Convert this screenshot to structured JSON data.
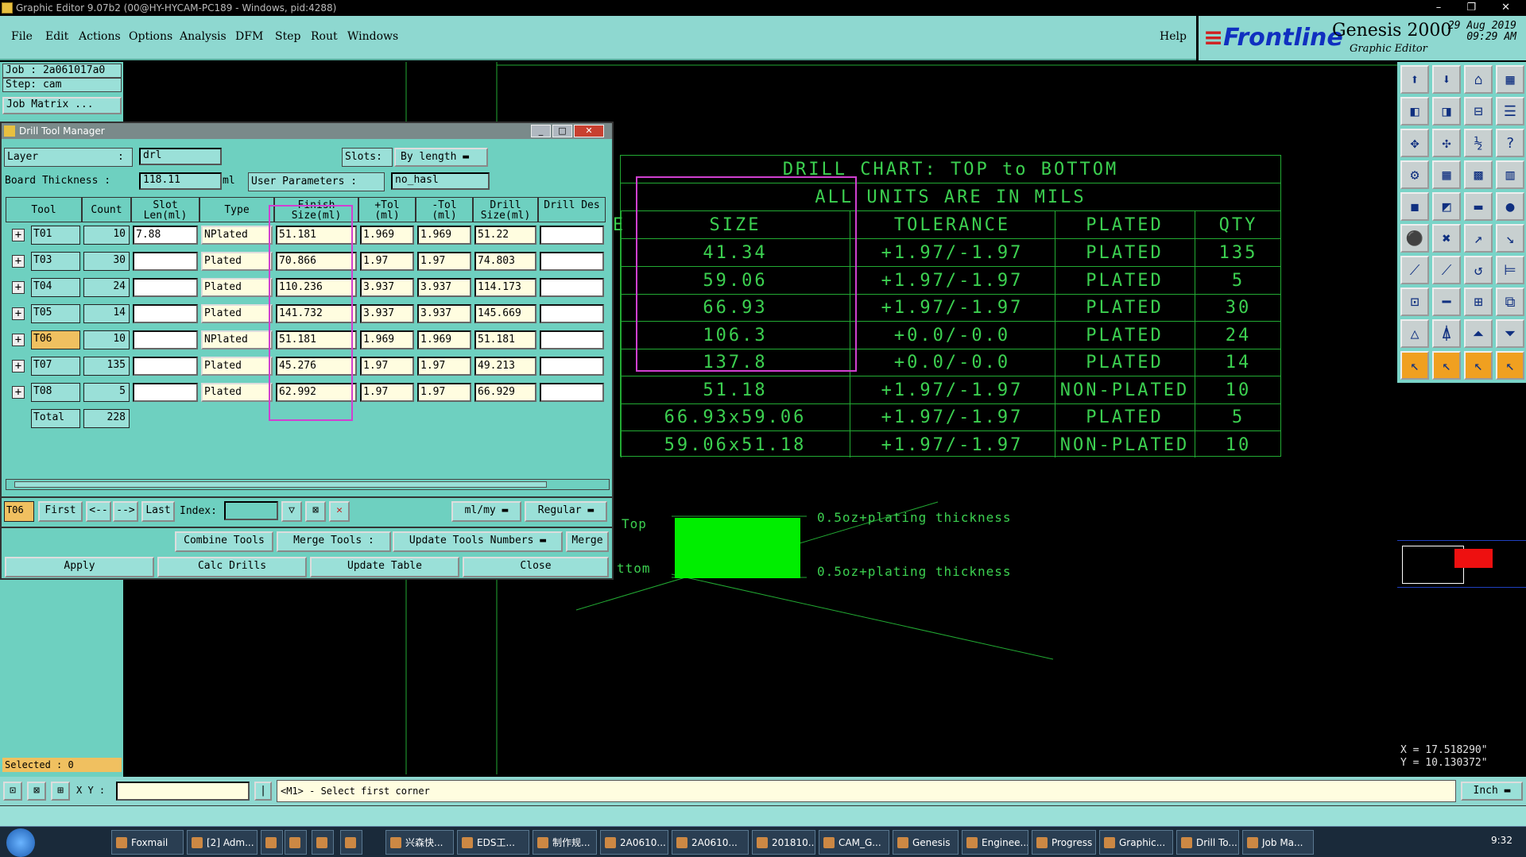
{
  "titlebar": {
    "text": "Graphic Editor 9.07b2 (00@HY-HYCAM-PC189 - Windows, pid:4288)",
    "controls": "– ❐ ✕"
  },
  "menu": [
    "File",
    "Edit",
    "Actions",
    "Options",
    "Analysis",
    "DFM",
    "Step",
    "Rout",
    "Windows"
  ],
  "help": "Help",
  "brand": {
    "logo": "Frontline",
    "product": "Genesis 2000",
    "subtitle": "Graphic Editor",
    "date": "29 Aug 2019",
    "time": "09:29 AM"
  },
  "left": {
    "job": "Job : 2a061017a0",
    "step": "Step: cam",
    "job_matrix": "Job Matrix ...",
    "selected": "Selected : 0"
  },
  "dialog": {
    "title": "Drill Tool Manager",
    "layer_label": "Layer",
    "layer_sep": ":",
    "layer_value": "drl",
    "slots_label": "Slots:",
    "slots_value": "By length",
    "board_label": "Board Thickness :",
    "board_value": "118.11",
    "board_unit": "ml",
    "user_params_label": "User Parameters :",
    "user_params_value": "no_hasl",
    "columns": [
      "Tool",
      "Count",
      "Slot Len(ml)",
      "Type",
      "Finish Size(ml)",
      "+Tol (ml)",
      "-Tol (ml)",
      "Drill Size(ml)",
      "Drill Des"
    ],
    "rows": [
      {
        "tool": "T01",
        "count": "10",
        "slot": "7.88",
        "type": "NPlated",
        "finish": "51.181",
        "ptol": "1.969",
        "ntol": "1.969",
        "drill": "51.22",
        "des": ""
      },
      {
        "tool": "T03",
        "count": "30",
        "slot": "",
        "type": "Plated",
        "finish": "70.866",
        "ptol": "1.97",
        "ntol": "1.97",
        "drill": "74.803",
        "des": ""
      },
      {
        "tool": "T04",
        "count": "24",
        "slot": "",
        "type": "Plated",
        "finish": "110.236",
        "ptol": "3.937",
        "ntol": "3.937",
        "drill": "114.173",
        "des": ""
      },
      {
        "tool": "T05",
        "count": "14",
        "slot": "",
        "type": "Plated",
        "finish": "141.732",
        "ptol": "3.937",
        "ntol": "3.937",
        "drill": "145.669",
        "des": ""
      },
      {
        "tool": "T06",
        "count": "10",
        "slot": "",
        "type": "NPlated",
        "finish": "51.181",
        "ptol": "1.969",
        "ntol": "1.969",
        "drill": "51.181",
        "des": ""
      },
      {
        "tool": "T07",
        "count": "135",
        "slot": "",
        "type": "Plated",
        "finish": "45.276",
        "ptol": "1.97",
        "ntol": "1.97",
        "drill": "49.213",
        "des": ""
      },
      {
        "tool": "T08",
        "count": "5",
        "slot": "",
        "type": "Plated",
        "finish": "62.992",
        "ptol": "1.97",
        "ntol": "1.97",
        "drill": "66.929",
        "des": ""
      }
    ],
    "total_label": "Total",
    "total_value": "228",
    "current_tool": "T06",
    "nav": {
      "first": "First",
      "prev": "<--",
      "next": "-->",
      "last": "Last",
      "index_label": "Index:"
    },
    "units_value": "ml/my",
    "mode_value": "Regular",
    "combine": "Combine Tools",
    "merge_tools": "Merge Tools :",
    "update_numbers": "Update Tools Numbers",
    "merge": "Merge",
    "apply": "Apply",
    "calc": "Calc Drills",
    "update_table": "Update Table",
    "close": "Close"
  },
  "chart": {
    "title": "DRILL CHART: TOP to BOTTOM",
    "subtitle": "ALL UNITS ARE IN MILS",
    "left_fragment": "E",
    "headers": [
      "SIZE",
      "TOLERANCE",
      "PLATED",
      "QTY"
    ],
    "rows": [
      [
        "41.34",
        "+1.97/-1.97",
        "PLATED",
        "135"
      ],
      [
        "59.06",
        "+1.97/-1.97",
        "PLATED",
        "5"
      ],
      [
        "66.93",
        "+1.97/-1.97",
        "PLATED",
        "30"
      ],
      [
        "106.3",
        "+0.0/-0.0",
        "PLATED",
        "24"
      ],
      [
        "137.8",
        "+0.0/-0.0",
        "PLATED",
        "14"
      ],
      [
        "51.18",
        "+1.97/-1.97",
        "NON-PLATED",
        "10"
      ],
      [
        "66.93x59.06",
        "+1.97/-1.97",
        "PLATED",
        "5"
      ],
      [
        "59.06x51.18",
        "+1.97/-1.97",
        "NON-PLATED",
        "10"
      ]
    ]
  },
  "stack": {
    "top_label": "Top",
    "bottom_label": "ttom",
    "top_note": "0.5oz+plating thickness",
    "bottom_note": "0.5oz+plating thickness"
  },
  "coords": {
    "x": "X = 17.518290\"",
    "y": "Y = 10.130372\""
  },
  "status": {
    "xy_label": "X Y :",
    "prompt": "<M1> - Select first corner",
    "units": "Inch"
  },
  "taskbar": {
    "items": [
      "Foxmail",
      "[2] Adm...",
      "",
      "",
      "",
      "",
      "兴森快...",
      "EDS工...",
      "制作规...",
      "2A0610...",
      "2A0610...",
      "201810...",
      "CAM_G...",
      "Genesis",
      "Enginee...",
      "Progress",
      "Graphic...",
      "Drill To...",
      "Job Ma..."
    ],
    "clock": "9:32"
  },
  "colors": {
    "teal": "#6ed0c0",
    "light_teal": "#9ae0d8",
    "chart_green": "#3cd050",
    "stack_green": "#00ee00",
    "highlight": "#f0c060",
    "magenta": "#d040d0"
  }
}
